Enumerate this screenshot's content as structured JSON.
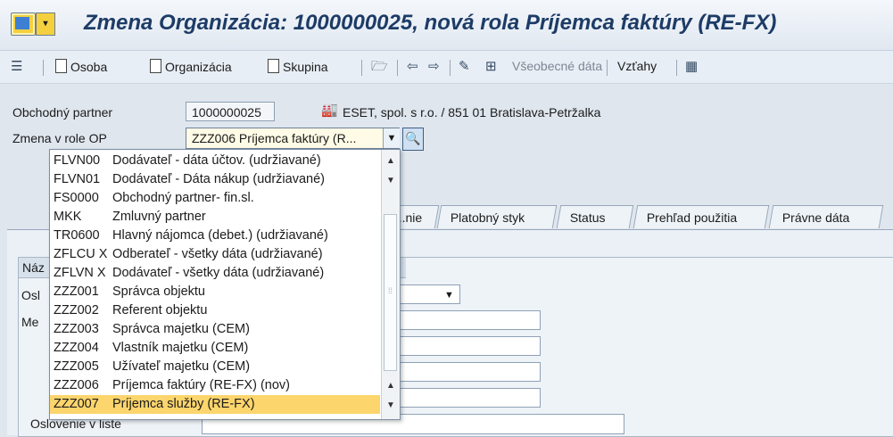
{
  "window": {
    "title": "Zmena Organizácia: 1000000025, nová rola Príjemca faktúry (RE-FX)"
  },
  "toolbar": {
    "osoba": "Osoba",
    "organizacia": "Organizácia",
    "skupina": "Skupina",
    "vseobecne_data": "Všeobecné dáta",
    "vztahy": "Vzťahy"
  },
  "form": {
    "partner_label": "Obchodný partner",
    "partner_value": "1000000025",
    "partner_description": "ESET, spol. s r.o. / 851 01 Bratislava-Petržalka",
    "role_label": "Zmena v role OP",
    "role_value": "ZZZ006 Príjemca faktúry (R..."
  },
  "tabs": [
    {
      "label": "...nie"
    },
    {
      "label": "Platobný styk"
    },
    {
      "label": "Status"
    },
    {
      "label": "Prehľad použitia"
    },
    {
      "label": "Právne dáta"
    }
  ],
  "panel": {
    "header": "Náz",
    "label_1": "Osl",
    "label_2": "Me",
    "label_bottom": "Oslovenie v liste"
  },
  "dropdown": {
    "items": [
      {
        "code": "FLVN00",
        "text": "Dodávateľ - dáta účtov. (udržiavané)"
      },
      {
        "code": "FLVN01",
        "text": "Dodávateľ - Dáta nákup (udržiavané)"
      },
      {
        "code": "FS0000",
        "text": "Obchodný partner- fin.sl."
      },
      {
        "code": "MKK",
        "text": "Zmluvný partner"
      },
      {
        "code": "TR0600",
        "text": "Hlavný nájomca (debet.) (udržiavané)"
      },
      {
        "code": "ZFLCU X",
        "text": "Odberateľ - všetky dáta (udržiavané)"
      },
      {
        "code": "ZFLVN X",
        "text": "Dodávateľ - všetky dáta (udržiavané)"
      },
      {
        "code": "ZZZ001",
        "text": "Správca objektu"
      },
      {
        "code": "ZZZ002",
        "text": "Referent objektu"
      },
      {
        "code": "ZZZ003",
        "text": "Správca majetku (CEM)"
      },
      {
        "code": "ZZZ004",
        "text": "Vlastník majetku (CEM)"
      },
      {
        "code": "ZZZ005",
        "text": "Užívateľ majetku (CEM)"
      },
      {
        "code": "ZZZ006",
        "text": "Príjemca faktúry (RE-FX) (nov)"
      },
      {
        "code": "ZZZ007",
        "text": "Príjemca služby (RE-FX)"
      }
    ],
    "selected_color": "#fcd56c"
  },
  "icons": {
    "title": "sap-screen-icon",
    "find": "search-icon",
    "open": "folder-open-icon",
    "back": "arrow-left-icon",
    "forward": "arrow-right-icon"
  }
}
